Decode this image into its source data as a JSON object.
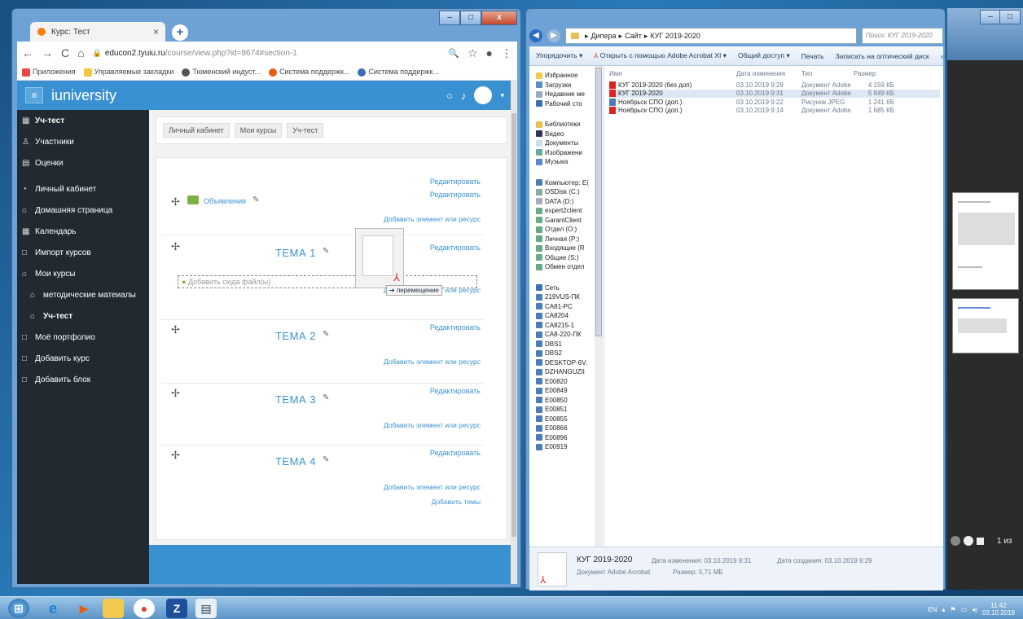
{
  "chrome": {
    "tab_title": "Курс: Тест",
    "tab_close": "×",
    "new_tab": "+",
    "url_main": "educon2.tyuiu.ru",
    "url_path": "/course/view.php?id=8674#section-1",
    "bookmarks": [
      "Приложения",
      "Управляемые закладки",
      "Тюменский индуст...",
      "Система поддержк...",
      "Система поддержк..."
    ]
  },
  "moodle": {
    "brand": "iuniversity",
    "sidebar": [
      "Уч-тест",
      "Участники",
      "Оценки",
      "Личный кабинет",
      "Домашняя страница",
      "Календарь",
      "Импорт курсов",
      "Мои курсы",
      "методические матеиалы",
      "Уч-тест",
      "Моё портфолио",
      "Добавить курс",
      "Добавить блок"
    ],
    "breadcrumb": [
      "Личный кабинет",
      "Мои курсы",
      "Уч-тест"
    ],
    "announcements": "Объявления",
    "edit": "Редактировать",
    "add_element": "Добавить элемент или ресурс",
    "add_topics": "Добавить темы",
    "drop_files": "Добавить сюда файл(ы)",
    "move_label": "перемещение",
    "topics": [
      "ТЕМА 1",
      "ТЕМА 2",
      "ТЕМА 3",
      "ТЕМА 4"
    ]
  },
  "explorer": {
    "path": [
      "Дипера",
      "Сайт",
      "КУГ 2019-2020"
    ],
    "search_placeholder": "Поиск: КУГ 2019-2020",
    "toolbar": [
      "Упорядочить ▾",
      "Открыть с помощью Adobe Acrobat XI ▾",
      "Общий доступ ▾",
      "Печать",
      "Записать на оптический диск",
      "»"
    ],
    "nav": {
      "favorites": [
        "Избранное",
        "Загрузки",
        "Недавние ме",
        "Рабочий сто"
      ],
      "libraries": [
        "Библиотеки",
        "Видео",
        "Документы",
        "Изображени",
        "Музыка"
      ],
      "computer": [
        "Компьютер: Е(",
        "OSDisk (C:)",
        "DATA (D:)",
        "expert2client",
        "GarantClient",
        "Отдел (O:)",
        "Личная (P:)",
        "Входящие (R",
        "Общие (S:)",
        "Обмен отдел"
      ],
      "network": [
        "Сеть",
        "219VUS-ПК",
        "CA81-PC",
        "CA8204",
        "CA8215-1",
        "CA8-220-ПК",
        "DBS1",
        "DBS2",
        "DESKTOP-6V.",
        "DZHANGUZII",
        "E00820",
        "E00849",
        "E00850",
        "E00851",
        "E00855",
        "E00866",
        "E00896",
        "E00919"
      ]
    },
    "columns": [
      "Имя",
      "Дата изменения",
      "Тип",
      "Размер"
    ],
    "files": [
      {
        "name": "КУГ 2019-2020 (без доп)",
        "date": "03.10.2019 9:29",
        "type": "Документ Adobe ...",
        "size": "4 159 КБ",
        "icon": "pdf"
      },
      {
        "name": "КУГ 2019-2020",
        "date": "03.10.2019 9:31",
        "type": "Документ Adobe ...",
        "size": "5 849 КБ",
        "icon": "pdf"
      },
      {
        "name": "Ноябрьск СПО (доп.)",
        "date": "03.10.2019 9:22",
        "type": "Рисунок JPEG",
        "size": "1 241 КБ",
        "icon": "jpg"
      },
      {
        "name": "Ноябрьск СПО (доп.)",
        "date": "03.10.2019 9:14",
        "type": "Документ Adobe ...",
        "size": "1 685 КБ",
        "icon": "pdf"
      }
    ],
    "details": {
      "name": "КУГ 2019-2020",
      "type": "Документ Adobe Acrobat",
      "modified": "Дата изменения: 03.10.2019 9:31",
      "size": "Размер: 5,71 МБ",
      "created": "Дата создания: 03.10.2019 9:29"
    }
  },
  "viewer": {
    "page_info": "1 из"
  },
  "taskbar": {
    "lang": "EN",
    "time": "11:42",
    "date": "03.10.2019"
  },
  "colors": {
    "moodle_blue": "#3a91d1",
    "sidebar_dark": "#222a31"
  }
}
